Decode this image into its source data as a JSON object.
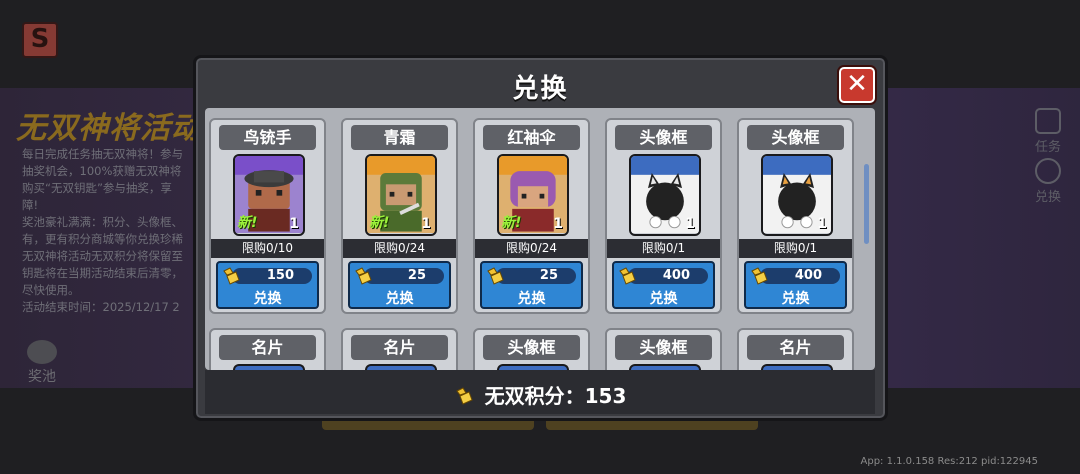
{
  "background": {
    "event_title": "无双神将活动",
    "description_lines": [
      "每日完成任务抽无双神将！参与",
      "抽奖机会，100%获赠无双神将",
      "购买“无双钥匙”参与抽奖，享",
      "障!",
      "奖池豪礼满满：积分、头像框、",
      "有，更有积分商城等你兑换珍稀",
      "无双神将活动无双积分将保留至",
      "钥匙将在当期活动结束后清零，",
      "尽快使用。",
      "活动结束时间：2025/12/17 2"
    ],
    "pool_label": "奖池",
    "side_buttons": [
      "任务",
      "兑换"
    ]
  },
  "modal": {
    "title": "兑换",
    "close_icon": "close-x",
    "button_label": "兑换",
    "new_tag": "新!",
    "row1": [
      {
        "name": "鸟铳手",
        "limit": "限购0/10",
        "price": "150",
        "qty": "1",
        "is_new": true,
        "frame": "purple",
        "icon": "musketeer-avatar"
      },
      {
        "name": "青霜",
        "limit": "限购0/24",
        "price": "25",
        "qty": "1",
        "is_new": true,
        "frame": "orange",
        "icon": "qingshuang-avatar"
      },
      {
        "name": "红袖伞",
        "limit": "限购0/24",
        "price": "25",
        "qty": "1",
        "is_new": true,
        "frame": "orange",
        "icon": "hongxiusan-avatar"
      },
      {
        "name": "头像框",
        "limit": "限购0/1",
        "price": "400",
        "qty": "1",
        "is_new": false,
        "frame": "blue",
        "icon": "cat-white-ears-avatar-frame"
      },
      {
        "name": "头像框",
        "limit": "限购0/1",
        "price": "400",
        "qty": "1",
        "is_new": false,
        "frame": "blue",
        "icon": "cat-orange-ears-avatar-frame"
      }
    ],
    "row2": [
      {
        "name": "名片"
      },
      {
        "name": "名片"
      },
      {
        "name": "头像框"
      },
      {
        "name": "头像框"
      },
      {
        "name": "名片"
      }
    ],
    "points_label": "无双积分：153"
  },
  "footer": "App: 1.1.0.158 Res:212 pid:122945",
  "colors": {
    "modal_bg": "#3a3b40",
    "close_red": "#c8392e",
    "button_blue": "#2f86d4",
    "new_green": "#9bf23a",
    "coin_gold": "#f1c232"
  }
}
